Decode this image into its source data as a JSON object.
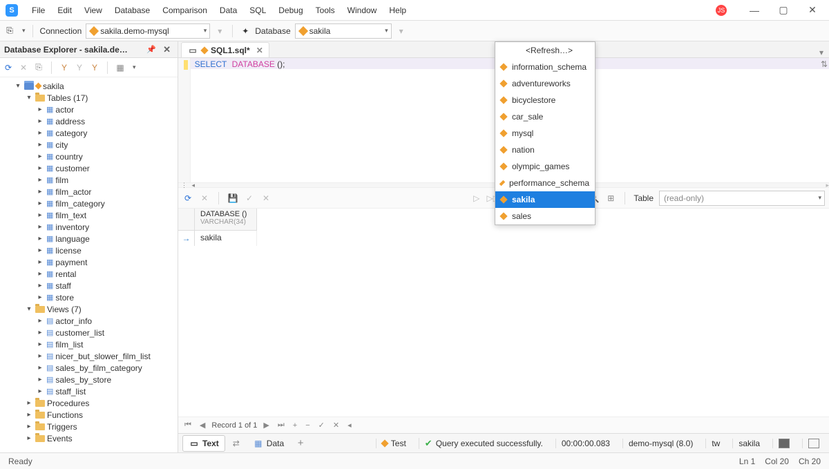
{
  "menu": [
    "File",
    "Edit",
    "View",
    "Database",
    "Comparison",
    "Data",
    "SQL",
    "Debug",
    "Tools",
    "Window",
    "Help"
  ],
  "toolbar": {
    "connection_label": "Connection",
    "connection_value": "sakila.demo-mysql",
    "database_label": "Database",
    "database_value": "sakila"
  },
  "dropdown": {
    "refresh": "<Refresh…>",
    "items": [
      "information_schema",
      "adventureworks",
      "bicyclestore",
      "car_sale",
      "mysql",
      "nation",
      "olympic_games",
      "performance_schema",
      "sakila",
      "sales"
    ],
    "selected": "sakila"
  },
  "explorer": {
    "title": "Database Explorer - sakila.de…",
    "root": "sakila",
    "tables_label": "Tables (17)",
    "tables": [
      "actor",
      "address",
      "category",
      "city",
      "country",
      "customer",
      "film",
      "film_actor",
      "film_category",
      "film_text",
      "inventory",
      "language",
      "license",
      "payment",
      "rental",
      "staff",
      "store"
    ],
    "views_label": "Views (7)",
    "views": [
      "actor_info",
      "customer_list",
      "film_list",
      "nicer_but_slower_film_list",
      "sales_by_film_category",
      "sales_by_store",
      "staff_list"
    ],
    "nodes": [
      "Procedures",
      "Functions",
      "Triggers",
      "Events"
    ]
  },
  "tab": {
    "title": "SQL1.sql*"
  },
  "sql": {
    "select": "SELECT",
    "database": "DATABASE",
    "rest": " ();"
  },
  "results": {
    "table_label": "Table",
    "table_mode": "(read-only)",
    "col_name": "DATABASE ()",
    "col_type": "VARCHAR(34)",
    "row0": "sakila"
  },
  "nav": {
    "record": "Record 1 of 1"
  },
  "btabs": {
    "text": "Text",
    "data": "Data"
  },
  "status": {
    "test": "Test",
    "exec": "Query executed successfully.",
    "time": "00:00:00.083",
    "server": "demo-mysql (8.0)",
    "user": "tw",
    "db": "sakila"
  },
  "footer": {
    "ready": "Ready",
    "ln": "Ln 1",
    "col": "Col 20",
    "ch": "Ch 20"
  }
}
